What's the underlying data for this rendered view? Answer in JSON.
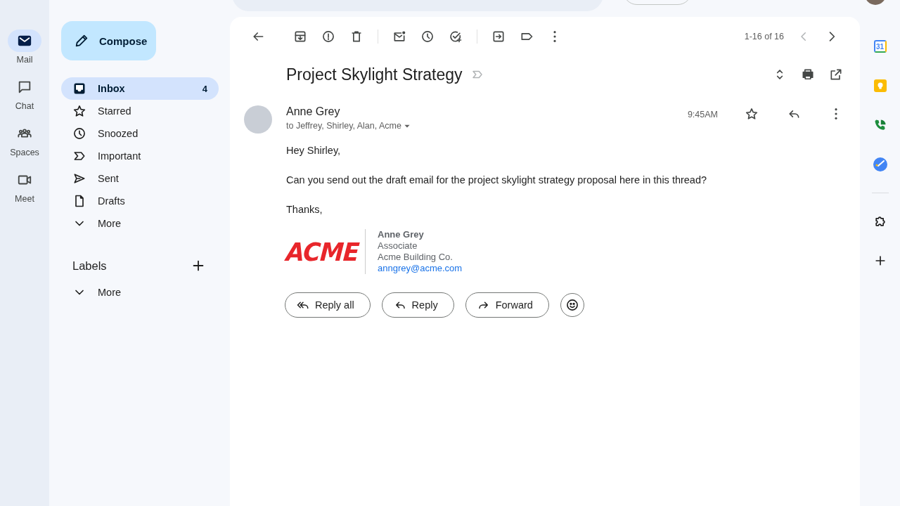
{
  "rail": [
    {
      "label": "Mail",
      "selected": true
    },
    {
      "label": "Chat",
      "selected": false
    },
    {
      "label": "Spaces",
      "selected": false
    },
    {
      "label": "Meet",
      "selected": false
    }
  ],
  "compose": "Compose",
  "folders": [
    {
      "label": "Inbox",
      "count": "4",
      "selected": true
    },
    {
      "label": "Starred",
      "selected": false
    },
    {
      "label": "Snoozed",
      "selected": false
    },
    {
      "label": "Important",
      "selected": false
    },
    {
      "label": "Sent",
      "selected": false
    },
    {
      "label": "Drafts",
      "selected": false
    },
    {
      "label": "More",
      "selected": false
    }
  ],
  "labels": {
    "title": "Labels",
    "items": [
      {
        "label": "More"
      }
    ]
  },
  "toolbar": {
    "pager": "1-16 of 16",
    "prev_disabled": true
  },
  "thread": {
    "subject": "Project Skylight Strategy"
  },
  "message": {
    "sender": "Anne Grey",
    "recipients": "to Jeffrey, Shirley, Alan, Acme",
    "time": "9:45AM",
    "body": [
      "Hey Shirley,",
      "Can you send out the draft email for the project skylight strategy proposal here in this thread?",
      "Thanks,"
    ],
    "signature": {
      "logo": "ACME",
      "name": "Anne Grey",
      "title": "Associate",
      "company": "Acme Building Co.",
      "email": "anngrey@acme.com"
    }
  },
  "actions": [
    "Reply all",
    "Reply",
    "Forward"
  ],
  "apps": {
    "calendar_day": "31"
  }
}
